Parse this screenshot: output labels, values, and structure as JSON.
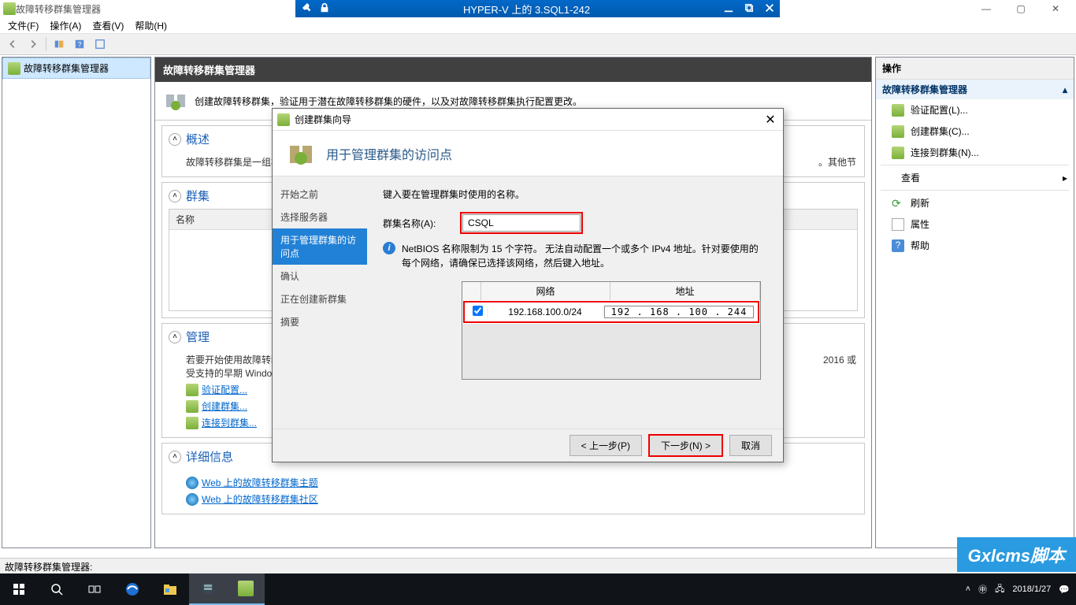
{
  "vm_bar": {
    "title": "HYPER-V 上的 3.SQL1-242"
  },
  "main_window": {
    "title": "故障转移群集管理器"
  },
  "menubar": [
    "文件(F)",
    "操作(A)",
    "查看(V)",
    "帮助(H)"
  ],
  "tree": {
    "root": "故障转移群集管理器"
  },
  "center": {
    "header": "故障转移群集管理器",
    "desc": "创建故障转移群集，验证用于潜在故障转移群集的硬件，以及对故障转移群集执行配置更改。",
    "overview": {
      "title": "概述",
      "text": "故障转移群集是一组相互……点将开始提供服务。此过",
      "extra": "。其他节"
    },
    "clusters": {
      "title": "群集",
      "col": "名称"
    },
    "manage": {
      "title": "管理",
      "text1": "若要开始使用故障转移群集",
      "text2": "受支持的早期 Windows S",
      "text_tail": "2016 或",
      "links": [
        "验证配置...",
        "创建群集...",
        "连接到群集..."
      ]
    },
    "detail": {
      "title": "详细信息",
      "links": [
        "Web 上的故障转移群集主题",
        "Web 上的故障转移群集社区"
      ]
    }
  },
  "actions": {
    "header": "操作",
    "sub": "故障转移群集管理器",
    "items": [
      "验证配置(L)...",
      "创建群集(C)...",
      "连接到群集(N)..."
    ],
    "view": "查看",
    "items2": [
      "刷新",
      "属性",
      "帮助"
    ]
  },
  "wizard": {
    "title": "创建群集向导",
    "banner": "用于管理群集的访问点",
    "nav": [
      "开始之前",
      "选择服务器",
      "用于管理群集的访问点",
      "确认",
      "正在创建新群集",
      "摘要"
    ],
    "nav_active": 2,
    "content": {
      "prompt": "键入要在管理群集时使用的名称。",
      "name_label": "群集名称(A):",
      "name_value": "CSQL",
      "info": "NetBIOS 名称限制为 15 个字符。 无法自动配置一个或多个 IPv4 地址。针对要使用的每个网络，请确保已选择该网络，然后键入地址。",
      "table": {
        "col1": "网络",
        "col2": "地址",
        "network": "192.168.100.0/24",
        "address": "192 . 168 . 100 . 244"
      }
    },
    "buttons": {
      "prev": "< 上一步(P)",
      "next": "下一步(N) >",
      "cancel": "取消"
    }
  },
  "statusbar": "故障转移群集管理器:",
  "tray": {
    "date": "2018/1/27"
  },
  "watermark": "Gxlcms脚本"
}
